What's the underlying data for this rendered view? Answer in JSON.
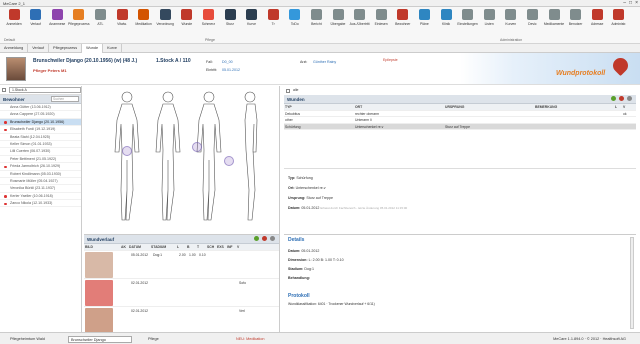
{
  "app": {
    "title": "MeCare 2_1",
    "win_controls": [
      "–",
      "□",
      "×"
    ]
  },
  "toolbar": {
    "items": [
      {
        "label": "Anmelden",
        "icon": "person-key-icon",
        "color": "#c0392b"
      },
      {
        "label": "Verlauf",
        "icon": "person-list-icon",
        "color": "#2e6fb5"
      },
      {
        "label": "Anamnese",
        "icon": "clipboard-icon",
        "color": "#8e44ad"
      },
      {
        "label": "Pflegeprozess",
        "icon": "gear-icon",
        "color": "#e67e22"
      },
      {
        "label": "ATL",
        "icon": "gear-cycle-icon",
        "color": "#7f8c8d"
      },
      {
        "label": "Vitalw.",
        "icon": "heartbeat-icon",
        "color": "#c0392b"
      },
      {
        "label": "Medikation",
        "icon": "pill-icon",
        "color": "#d35400"
      },
      {
        "label": "Verordnung",
        "icon": "prescription-icon",
        "color": "#34495e"
      },
      {
        "label": "Wunde",
        "icon": "wound-heart-icon",
        "color": "#c0392b"
      },
      {
        "label": "Schmerz",
        "icon": "pain-icon",
        "color": "#e74c3c"
      },
      {
        "label": "Sturz",
        "icon": "fall-icon",
        "color": "#2c3e50"
      },
      {
        "label": "Kurve",
        "icon": "chart-curve-icon",
        "color": "#2c3e50"
      },
      {
        "label": "Tr",
        "icon": "drop-icon",
        "color": "#c0392b"
      },
      {
        "label": "ToDo",
        "icon": "checkbox-icon",
        "color": "#3498db"
      },
      {
        "label": "Bericht",
        "icon": "report-icon",
        "color": "#7f8c8d"
      },
      {
        "label": "Übergabe",
        "icon": "handover-icon",
        "color": "#7f8c8d"
      },
      {
        "label": "Aus-/Übertritt",
        "icon": "transfer-icon",
        "color": "#7f8c8d"
      },
      {
        "label": "Einlesen",
        "icon": "import-icon",
        "color": "#7f8c8d"
      },
      {
        "label": "Bewohner",
        "icon": "resident-icon",
        "color": "#c0392b"
      },
      {
        "label": "Pläne",
        "icon": "hospital-icon",
        "color": "#2e86c1"
      },
      {
        "label": "Klinik",
        "icon": "clinic-icon",
        "color": "#2e86c1"
      },
      {
        "label": "Einstellungen",
        "icon": "settings-icon",
        "color": "#7f8c8d"
      },
      {
        "label": "Listen",
        "icon": "lists-icon",
        "color": "#7f8c8d"
      },
      {
        "label": "Kurven",
        "icon": "curves-icon",
        "color": "#7f8c8d"
      },
      {
        "label": "Devic",
        "icon": "device-icon",
        "color": "#7f8c8d"
      },
      {
        "label": "Medikamente",
        "icon": "medication-icon",
        "color": "#7f8c8d"
      },
      {
        "label": "Benutzer",
        "icon": "users-icon",
        "color": "#7f8c8d"
      },
      {
        "label": "Adresse",
        "icon": "address-icon",
        "color": "#c0392b"
      },
      {
        "label": "Administr.",
        "icon": "admin-icon",
        "color": "#c0392b"
      }
    ],
    "groups": [
      "Default",
      "Pflege",
      "Administration"
    ]
  },
  "tabs": [
    "Anmeldung",
    "Verlauf",
    "Pflegeprozess",
    "Wunde",
    "Kurve"
  ],
  "patient": {
    "name": "Brunschwiler Django (20.10.1956) (w) (48 J.)",
    "room": "1.Stock A / 110",
    "nurse": "Pfleger Peters M1",
    "fall_label": "Fall:",
    "fall_value": "D0_00",
    "eintritt_label": "Eintritt:",
    "eintritt_value": "05.01.2012",
    "arzt_label": "Arzt:",
    "arzt_value": "Günther Rainy",
    "allergy": "Epilepsie",
    "banner_title": "Wundprotokoll"
  },
  "residents": {
    "filter": "1.Stock A",
    "header": "Bewohner",
    "search_placeholder": "Suchen",
    "list": [
      {
        "name": "Anna Gütter (13.06.1912)",
        "flag": false
      },
      {
        "name": "Anna Cappere (27.05.1920)",
        "flag": false
      },
      {
        "name": "Brunschwiler Django (20.10.1956)",
        "flag": true,
        "selected": true
      },
      {
        "name": "Elisabeth Furdi (19.12.1919)",
        "flag": true
      },
      {
        "name": "Beata Stahl (12.04.1925)",
        "flag": false
      },
      {
        "name": "Keller Simon (01.01.1933)",
        "flag": false
      },
      {
        "name": "Lilli Cuerten (06.07.1930)",
        "flag": false
      },
      {
        "name": "Peter Bettiment (21.05.1922)",
        "flag": false
      },
      {
        "name": "Frieda Jarmoltrich (26.10.1929)",
        "flag": true
      },
      {
        "name": "Robert Kindlimann (05.03.1930)",
        "flag": false
      },
      {
        "name": "Rosmarie Müller (05.04.1927)",
        "flag": false
      },
      {
        "name": "Veronika Bürkli (23.11.1937)",
        "flag": false
      },
      {
        "name": "Kerler Yaeller (10.06.1918)",
        "flag": true
      },
      {
        "name": "Zanco Nikola (12.10.1933)",
        "flag": true
      }
    ]
  },
  "wounds": {
    "alle_label": "alle",
    "title": "Wunden",
    "columns": [
      "TYP",
      "ORT",
      "URSPRUNG",
      "BEMERKUNG",
      "L",
      "V"
    ],
    "rows": [
      [
        "Dekubitus",
        "rechter oberarm",
        "",
        "",
        "",
        "ok"
      ],
      [
        "other",
        "Unterarm li",
        "",
        "",
        "",
        ""
      ],
      [
        "Schürfung",
        "Unterschenkel re.v",
        "Sturz auf Treppe",
        "",
        "",
        ""
      ]
    ]
  },
  "detail": {
    "typ_label": "Typ:",
    "typ_value": "Schürfung",
    "ort_label": "Ort:",
    "ort_value": "Unterschenkel re.v",
    "ursprung_label": "Ursprung:",
    "ursprung_value": "Sturz auf Treppe",
    "datum_label": "Datum:",
    "datum_value": "05.01.2012",
    "meta": "Erfasst durch Fachbereich - letzte Änderung 05.01.2012 11:15:00"
  },
  "verlauf": {
    "title": "Wundverlauf",
    "columns": [
      "BILD",
      "",
      "AK",
      "DATUM",
      "STADIUM",
      "L",
      "B",
      "T",
      "SCH",
      "EXS",
      "INF",
      "V"
    ],
    "rows": [
      {
        "datum": "05.01.2012",
        "stadium": "Dog:1",
        "l": "2.00",
        "b": "1.00",
        "t": "0.10",
        "v": ""
      },
      {
        "datum": "02.01.2012",
        "stadium": "",
        "l": "",
        "b": "",
        "t": "",
        "v": "Sofo"
      },
      {
        "datum": "02.01.2012",
        "stadium": "",
        "l": "",
        "b": "",
        "t": "",
        "v": "Verl"
      }
    ]
  },
  "details_panel": {
    "title": "Details",
    "datum_label": "Datum:",
    "datum_value": "05.01.2012",
    "dim_label": "Dimension:",
    "dim_value": "L: 2.00  B: 1.00  T: 0.10",
    "stadium_label": "Stadium:",
    "stadium_value": "Dog:1",
    "behandlung_label": "Behandlung:",
    "protokoll_title": "Protokoll",
    "protokoll_line": "Wundklassifikation: 6401 · Trockener Wundverlauf + 6/11)"
  },
  "statusbar": {
    "left": "Pflegeheimtum Wald",
    "patient": "Brunschwiler Django",
    "mode": "Pflege",
    "new": "NEU: Medikation",
    "right": "MeCare 1.1.894.0 · © 2012 · Healthsoft AG"
  }
}
